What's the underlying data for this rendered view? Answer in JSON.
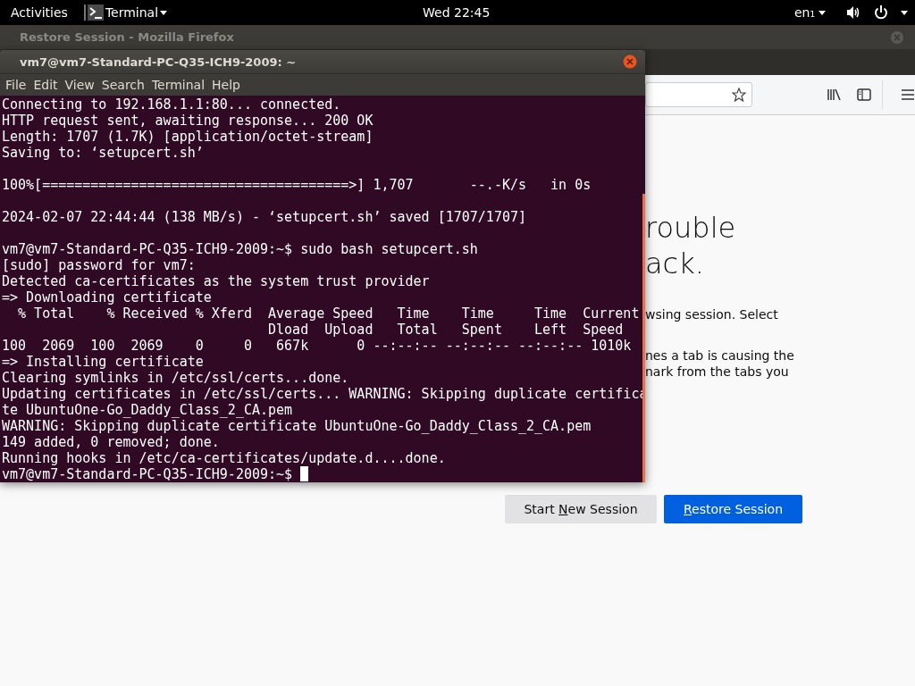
{
  "top_bar": {
    "activities": "Activities",
    "app_menu": "Terminal",
    "clock": "Wed 22:45",
    "keyboard_layout": "en₁"
  },
  "firefox": {
    "title": "Restore Session - Mozilla Firefox",
    "heading_lines": [
      "rouble",
      "ack."
    ],
    "paragraphs": [
      [
        "wsing session. Select"
      ],
      [
        "nes a tab is causing the",
        "nark from the tabs you"
      ]
    ],
    "buttons": [
      {
        "kind": "secondary",
        "before": "Start ",
        "mnemonic": "N",
        "after": "ew Session"
      },
      {
        "kind": "primary",
        "mnemonic": "R",
        "after": "estore Session"
      }
    ]
  },
  "terminal": {
    "title": "vm7@vm7-Standard-PC-Q35-ICH9-2009: ~",
    "menu": [
      "File",
      "Edit",
      "View",
      "Search",
      "Terminal",
      "Help"
    ],
    "blocks": [
      [
        "Connecting to 192.168.1.1:80... connected.",
        "HTTP request sent, awaiting response... 200 OK",
        "Length: 1707 (1.7K) [application/octet-stream]",
        "Saving to: ‘setupcert.sh’"
      ],
      [
        "100%[======================================>] 1,707       --.-K/s   in 0s"
      ],
      [
        "2024-02-07 22:44:44 (138 MB/s) - ‘setupcert.sh’ saved [1707/1707]"
      ],
      [
        "vm7@vm7-Standard-PC-Q35-ICH9-2009:~$ sudo bash setupcert.sh",
        "[sudo] password for vm7:",
        "Detected ca-certificates as the system trust provider",
        "=> Downloading certificate",
        "  % Total    % Received % Xferd  Average Speed   Time    Time     Time  Current",
        "                                 Dload  Upload   Total   Spent    Left  Speed",
        "100  2069  100  2069    0     0   667k      0 --:--:-- --:--:-- --:--:-- 1010k",
        "=> Installing certificate",
        "Clearing symlinks in /etc/ssl/certs...done.",
        "Updating certificates in /etc/ssl/certs... WARNING: Skipping duplicate certifica",
        "te UbuntuOne-Go_Daddy_Class_2_CA.pem",
        "WARNING: Skipping duplicate certificate UbuntuOne-Go_Daddy_Class_2_CA.pem",
        "149 added, 0 removed; done.",
        "Running hooks in /etc/ca-certificates/update.d....done."
      ]
    ],
    "prompt": "vm7@vm7-Standard-PC-Q35-ICH9-2009:~$"
  }
}
